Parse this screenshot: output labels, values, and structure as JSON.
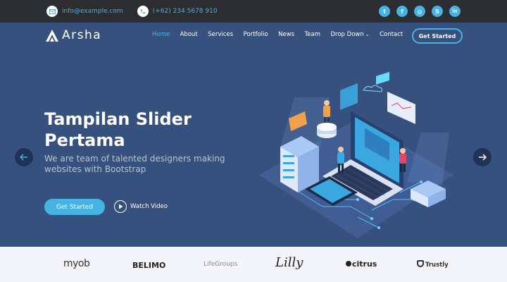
{
  "topbar": {
    "email": "info@example.com",
    "phone": "(+62) 234 5678 910",
    "socials": [
      {
        "icon": "twitter-icon",
        "glyph": "t"
      },
      {
        "icon": "facebook-icon",
        "glyph": "f"
      },
      {
        "icon": "instagram-icon",
        "glyph": "◎"
      },
      {
        "icon": "skype-icon",
        "glyph": "S"
      },
      {
        "icon": "linkedin-icon",
        "glyph": "in"
      }
    ]
  },
  "header": {
    "logo_text": "Arsha",
    "nav": [
      "Home",
      "About",
      "Services",
      "Portfolio",
      "News",
      "Team",
      "Drop Down",
      "Contact"
    ],
    "active_nav": "Home",
    "cta": "Get Started"
  },
  "hero": {
    "title": "Tampilan Slider Pertama",
    "subtitle": "We are team of talented designers making websites with Bootstrap",
    "primary_button": "Get Started",
    "video_link": "Watch Video"
  },
  "clients": [
    "myob",
    "BELIMO",
    "LifeGroups",
    "Lilly",
    "citrus",
    "Trustly"
  ],
  "colors": {
    "accent": "#47b2e4",
    "hero_bg": "#37517e",
    "topbar_bg": "#2b2d30",
    "clients_bg": "#f3f5fa"
  }
}
